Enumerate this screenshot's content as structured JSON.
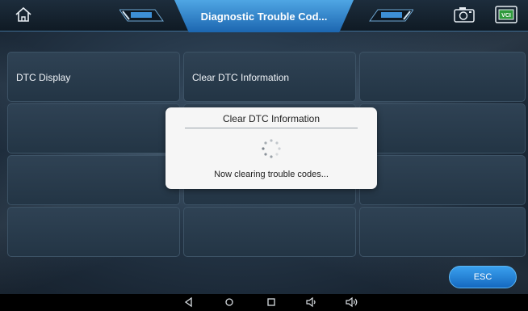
{
  "header": {
    "title": "Diagnostic Trouble Cod..."
  },
  "menu": {
    "items": [
      {
        "label": "DTC Display"
      },
      {
        "label": "Clear DTC Information"
      },
      {
        "label": ""
      },
      {
        "label": ""
      },
      {
        "label": ""
      },
      {
        "label": ""
      },
      {
        "label": ""
      },
      {
        "label": ""
      },
      {
        "label": ""
      },
      {
        "label": ""
      },
      {
        "label": ""
      },
      {
        "label": ""
      }
    ]
  },
  "dialog": {
    "title": "Clear DTC Information",
    "message": "Now clearing trouble codes..."
  },
  "footer": {
    "esc_label": "ESC"
  },
  "colors": {
    "accent": "#1c66b0",
    "title_bar": "#4fa6e4",
    "esc": "#1569c0"
  },
  "icons": [
    "home-icon",
    "camera-icon",
    "vci-icon",
    "back-icon",
    "home-circle-icon",
    "recents-icon",
    "volume-down-icon",
    "volume-up-icon"
  ]
}
